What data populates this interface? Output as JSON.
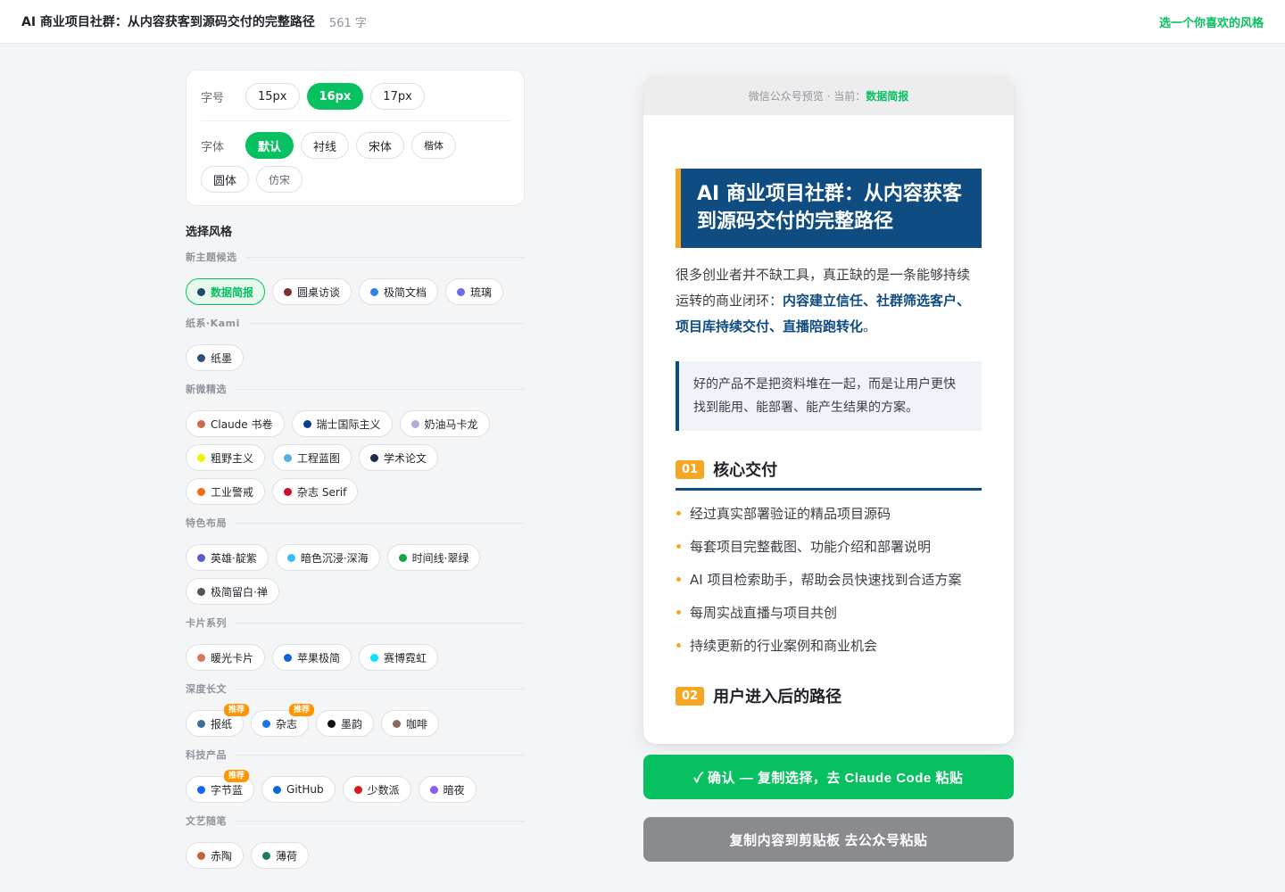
{
  "topbar": {
    "title": "AI 商业项目社群：从内容获客到源码交付的完整路径",
    "word_count": "561 字",
    "hint": "选一个你喜欢的风格"
  },
  "settings": {
    "font_size_label": "字号",
    "font_sizes": [
      "15px",
      "16px",
      "17px"
    ],
    "font_size_selected": "16px",
    "font_label": "字体",
    "fonts": [
      "默认",
      "衬线",
      "宋体",
      "楷体",
      "圆体",
      "仿宋"
    ],
    "font_selected": "默认"
  },
  "styles": {
    "heading": "选择风格",
    "selected": "数据简报",
    "badge_text": "推荐",
    "groups": [
      {
        "title": "新主题候选",
        "items": [
          {
            "label": "数据简报",
            "color": "#1e4a6e"
          },
          {
            "label": "圆桌访谈",
            "color": "#7a2e2e"
          },
          {
            "label": "极简文档",
            "color": "#2f80ed"
          },
          {
            "label": "琉璃",
            "color": "#6b6bf0"
          }
        ]
      },
      {
        "title": "纸系·Kami",
        "items": [
          {
            "label": "纸墨",
            "color": "#2c4f7c"
          }
        ]
      },
      {
        "title": "新微精选",
        "items": [
          {
            "label": "Claude 书卷",
            "color": "#cc6b49"
          },
          {
            "label": "瑞士国际主义",
            "color": "#0b3d91"
          },
          {
            "label": "奶油马卡龙",
            "color": "#b8a9d9"
          },
          {
            "label": "粗野主义",
            "color": "#f2f200"
          },
          {
            "label": "工程蓝图",
            "color": "#5aaee8"
          },
          {
            "label": "学术论文",
            "color": "#1c2e4a"
          },
          {
            "label": "工业警戒",
            "color": "#f26b0f"
          },
          {
            "label": "杂志 Serif",
            "color": "#c8102e"
          }
        ]
      },
      {
        "title": "特色布局",
        "items": [
          {
            "label": "英雄·靛紫",
            "color": "#5b5bd6"
          },
          {
            "label": "暗色沉浸·深海",
            "color": "#38bdf8"
          },
          {
            "label": "时间线·翠绿",
            "color": "#16a34a"
          },
          {
            "label": "极简留白·禅",
            "color": "#555555"
          }
        ]
      },
      {
        "title": "卡片系列",
        "items": [
          {
            "label": "暖光卡片",
            "color": "#d97757"
          },
          {
            "label": "苹果极简",
            "color": "#0a66d8"
          },
          {
            "label": "赛博霓虹",
            "color": "#00e5ff"
          }
        ]
      },
      {
        "title": "深度长文",
        "items": [
          {
            "label": "报纸",
            "color": "#3b6e99",
            "badge": true
          },
          {
            "label": "杂志",
            "color": "#1a73e8",
            "badge": true
          },
          {
            "label": "墨韵",
            "color": "#111111"
          },
          {
            "label": "咖啡",
            "color": "#8b6a5c"
          }
        ]
      },
      {
        "title": "科技产品",
        "items": [
          {
            "label": "字节蓝",
            "color": "#1664ff",
            "badge": true
          },
          {
            "label": "GitHub",
            "color": "#0969da"
          },
          {
            "label": "少数派",
            "color": "#d71a1b"
          },
          {
            "label": "暗夜",
            "color": "#8b5cf6"
          }
        ]
      },
      {
        "title": "文艺随笔",
        "items": [
          {
            "label": "赤陶",
            "color": "#c2623f"
          },
          {
            "label": "薄荷",
            "color": "#1f7a5c"
          }
        ]
      }
    ]
  },
  "preview": {
    "header_prefix": "微信公众号预览 · 当前：",
    "header_current": "数据简报",
    "title": "AI 商业项目社群：从内容获客到源码交付的完整路径",
    "intro_start": "很多创业者并不缺工具，真正缺的是一条能够持续运转的商业闭环：",
    "intro_highlight": "内容建立信任、社群筛选客户、项目库持续交付、直播陪跑转化",
    "intro_end": "。",
    "quote": "好的产品不是把资料堆在一起，而是让用户更快找到能用、能部署、能产生结果的方案。",
    "section1": {
      "num": "01",
      "title": "核心交付",
      "bullets": [
        "经过真实部署验证的精品项目源码",
        "每套项目完整截图、功能介绍和部署说明",
        "AI 项目检索助手，帮助会员快速找到合适方案",
        "每周实战直播与项目共创",
        "持续更新的行业案例和商业机会"
      ]
    },
    "section2": {
      "num": "02",
      "title": "用户进入后的路径"
    }
  },
  "buttons": {
    "confirm": "✓ 确认 — 复制选择，去 Claude Code 粘贴",
    "copy": "复制内容到剪贴板 去公众号粘贴"
  },
  "colors": {
    "accent": "#07c160",
    "theme_primary": "#0f4c81",
    "theme_accent": "#f5a623"
  }
}
